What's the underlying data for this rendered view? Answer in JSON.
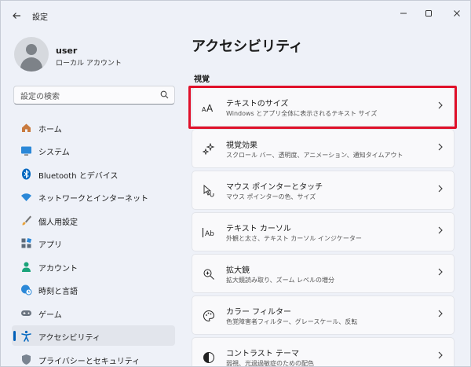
{
  "window": {
    "title": "設定"
  },
  "profile": {
    "name": "user",
    "subtitle": "ローカル アカウント"
  },
  "search": {
    "placeholder": "設定の検索"
  },
  "nav": [
    {
      "label": "ホーム",
      "icon": "home-icon"
    },
    {
      "label": "システム",
      "icon": "monitor-icon"
    },
    {
      "label": "Bluetooth とデバイス",
      "icon": "bluetooth-icon"
    },
    {
      "label": "ネットワークとインターネット",
      "icon": "wifi-icon"
    },
    {
      "label": "個人用設定",
      "icon": "brush-icon"
    },
    {
      "label": "アプリ",
      "icon": "apps-icon"
    },
    {
      "label": "アカウント",
      "icon": "person-icon"
    },
    {
      "label": "時刻と言語",
      "icon": "globe-clock-icon"
    },
    {
      "label": "ゲーム",
      "icon": "gamepad-icon"
    },
    {
      "label": "アクセシビリティ",
      "icon": "accessibility-icon"
    },
    {
      "label": "プライバシーとセキュリティ",
      "icon": "shield-icon"
    }
  ],
  "main": {
    "title": "アクセシビリティ",
    "section": "視覚",
    "cards": [
      {
        "title": "テキストのサイズ",
        "desc": "Windows とアプリ全体に表示されるテキスト サイズ",
        "icon": "text-size-icon"
      },
      {
        "title": "視覚効果",
        "desc": "スクロール バー、透明度、アニメーション、通知タイムアウト",
        "icon": "sparkle-icon"
      },
      {
        "title": "マウス ポインターとタッチ",
        "desc": "マウス ポインターの色、サイズ",
        "icon": "mouse-pointer-icon"
      },
      {
        "title": "テキスト カーソル",
        "desc": "外観と太さ、テキスト カーソル インジケーター",
        "icon": "text-cursor-icon"
      },
      {
        "title": "拡大鏡",
        "desc": "拡大鏡読み取り、ズーム レベルの増分",
        "icon": "magnifier-icon"
      },
      {
        "title": "カラー フィルター",
        "desc": "色覚障害者フィルター、グレースケール、反転",
        "icon": "palette-icon"
      },
      {
        "title": "コントラスト テーマ",
        "desc": "弱視、光過過敏症のための配色",
        "icon": "contrast-icon"
      }
    ]
  },
  "colors": {
    "accent": "#005fb8",
    "highlight": "#e0102a",
    "background": "#eef1f8"
  }
}
